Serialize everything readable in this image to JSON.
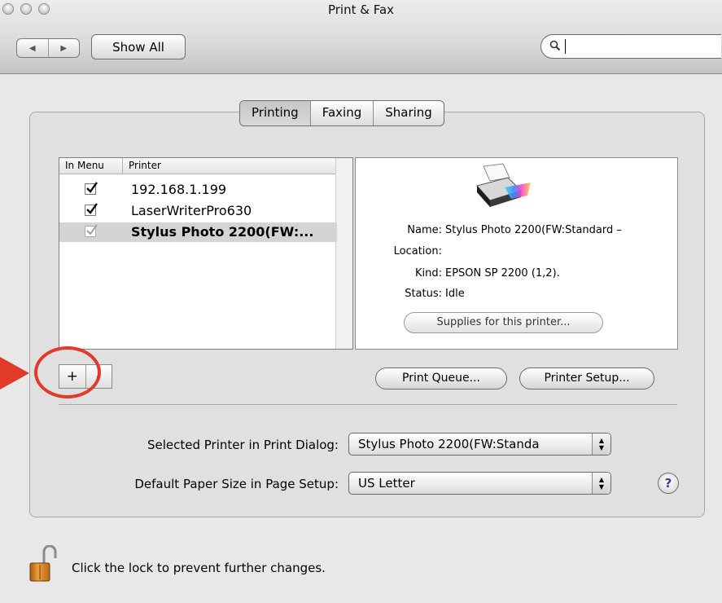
{
  "window": {
    "title": "Print & Fax"
  },
  "toolbar": {
    "nav_back": "◀",
    "nav_forward": "▶",
    "show_all_label": "Show All",
    "search_value": ""
  },
  "tabs": [
    {
      "label": "Printing",
      "selected": true
    },
    {
      "label": "Faxing",
      "selected": false
    },
    {
      "label": "Sharing",
      "selected": false
    }
  ],
  "printer_list": {
    "headers": {
      "in_menu": "In Menu",
      "printer": "Printer"
    },
    "rows": [
      {
        "name": "192.168.1.199",
        "in_menu": true,
        "selected": false
      },
      {
        "name": "LaserWriterPro630",
        "in_menu": true,
        "selected": false
      },
      {
        "name": "Stylus Photo 2200(FW:...",
        "in_menu": true,
        "selected": true
      }
    ]
  },
  "printer_info": {
    "name_label": "Name:",
    "name_value": "Stylus Photo 2200(FW:Standard –",
    "location_label": "Location:",
    "location_value": "",
    "kind_label": "Kind:",
    "kind_value": "EPSON SP 2200 (1,2).",
    "status_label": "Status:",
    "status_value": "Idle",
    "supplies_button": "Supplies for this printer..."
  },
  "list_buttons": {
    "add": "+",
    "remove": "-"
  },
  "buttons": {
    "print_queue": "Print Queue...",
    "printer_setup": "Printer Setup..."
  },
  "settings": {
    "selected_printer_label": "Selected Printer in Print Dialog:",
    "selected_printer_value": "Stylus Photo 2200(FW:Standa",
    "paper_size_label": "Default Paper Size in Page Setup:",
    "paper_size_value": "US Letter",
    "help": "?"
  },
  "lock": {
    "text": "Click the lock to prevent further changes."
  },
  "colors": {
    "annotation": "#e1392a",
    "help_mark": "#4a2fa0"
  },
  "icons": {
    "printer": "printer-icon",
    "lock": "lock-icon",
    "search": "search-icon",
    "help": "help-icon",
    "annotation_arrow": "arrow-icon"
  }
}
